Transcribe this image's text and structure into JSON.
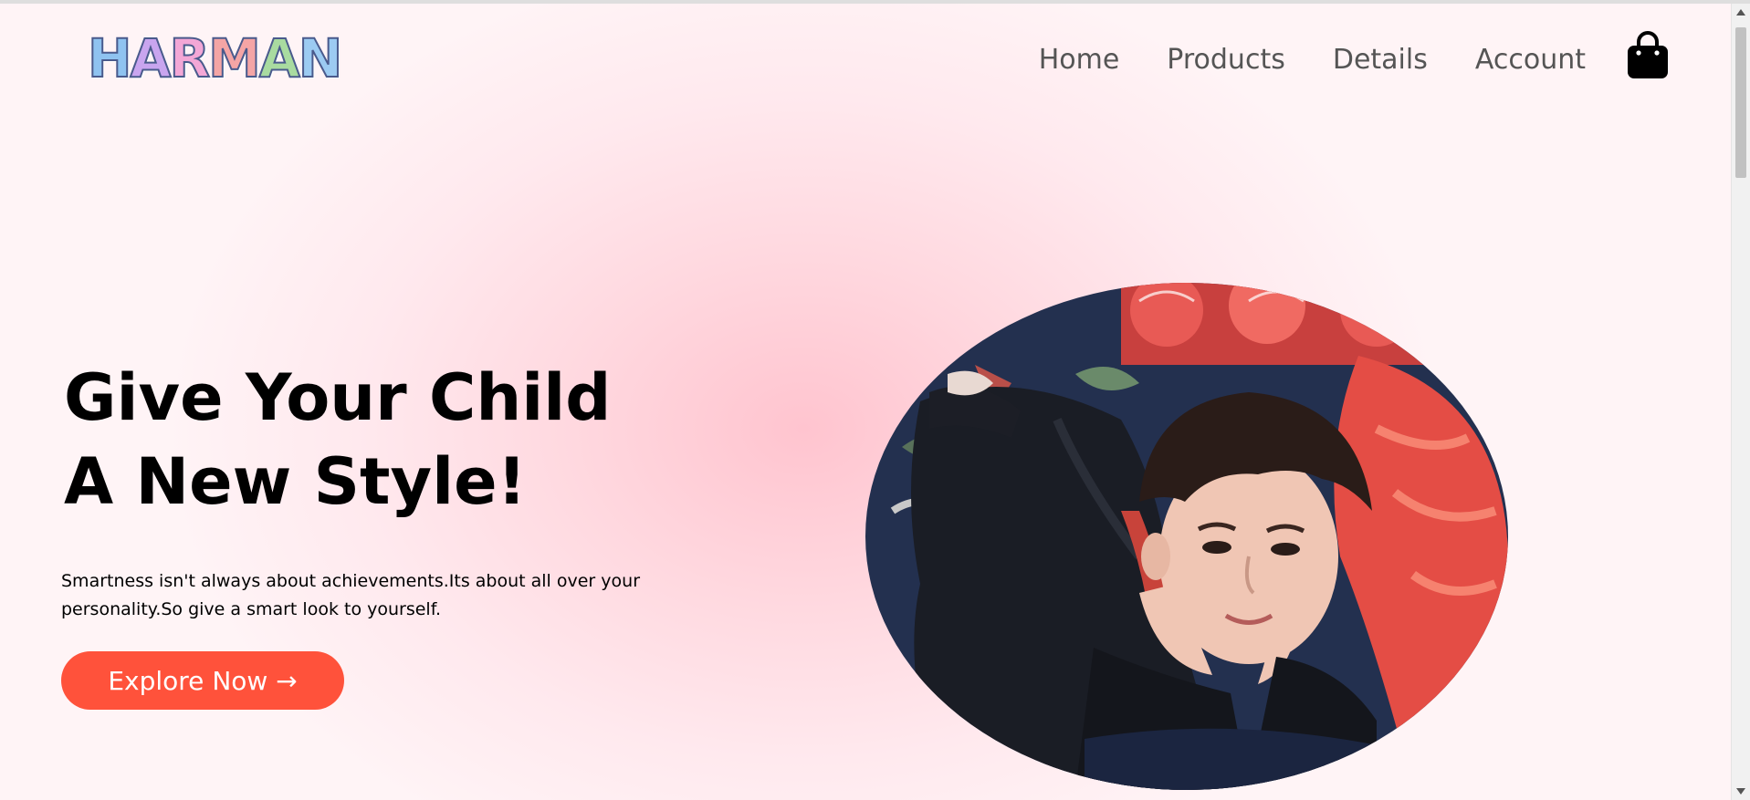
{
  "header": {
    "logo_text": "HARMAN",
    "logo_letters": [
      {
        "char": "H",
        "color": "#8fc3f0"
      },
      {
        "char": "A",
        "color": "#c9a5ef"
      },
      {
        "char": "R",
        "color": "#f3a7d6"
      },
      {
        "char": "M",
        "color": "#f4a5a5"
      },
      {
        "char": "A",
        "color": "#a9dba0"
      },
      {
        "char": "N",
        "color": "#9ccbf2"
      }
    ],
    "nav": [
      {
        "label": "Home"
      },
      {
        "label": "Products"
      },
      {
        "label": "Details"
      },
      {
        "label": "Account"
      }
    ],
    "cart_icon": "shopping-bag-icon"
  },
  "hero": {
    "headline_line1": "Give Your Child",
    "headline_line2": "A New Style!",
    "tagline": "Smartness isn't always about achievements.Its about all over your personality.So give a smart look to yourself.",
    "cta_label": "Explore Now →",
    "image_description_icon": "child-photo"
  },
  "colors": {
    "accent": "#ff523b",
    "nav_text": "#555555",
    "background_center": "#ffc4cf",
    "background_edge": "#fff4f6"
  }
}
